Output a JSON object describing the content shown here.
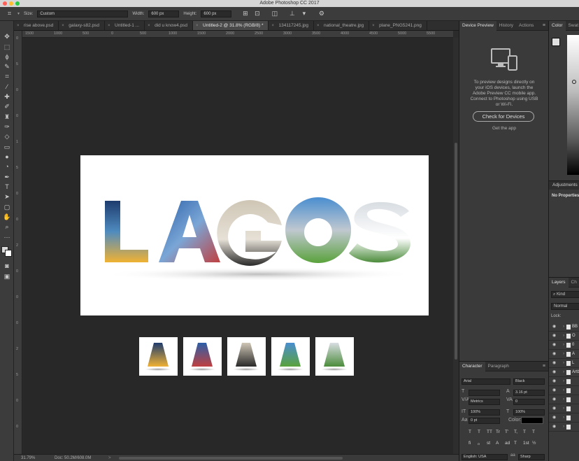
{
  "app": {
    "title": "Adobe Photoshop CC 2017"
  },
  "options_bar": {
    "size_label": "Size:",
    "size_value": "Custom",
    "width_label": "Width:",
    "width_value": "600 px",
    "height_label": "Height:",
    "height_value": "600 px"
  },
  "tabs": [
    {
      "label": "rise above.psd",
      "active": false
    },
    {
      "label": "galaxy-s82.psd",
      "active": false
    },
    {
      "label": "Untitled-1 ...",
      "active": false
    },
    {
      "label": "did u know4.psd",
      "active": false
    },
    {
      "label": "Untitled-2 @ 31.8% (RGB/8) *",
      "active": true
    },
    {
      "label": "134117245.jpg",
      "active": false
    },
    {
      "label": "national_theatre.jpg",
      "active": false
    },
    {
      "label": "plane_PNG5241.png",
      "active": false
    }
  ],
  "ruler_h": [
    "1500",
    "1000",
    "500",
    "0",
    "500",
    "1000",
    "1500",
    "2000",
    "2500",
    "3000",
    "3500",
    "4000",
    "4500",
    "5000",
    "5500",
    "6000"
  ],
  "ruler_v": [
    "0",
    "5",
    "0",
    "0",
    "1",
    "5",
    "0",
    "0",
    "2",
    "0",
    "0",
    "0",
    "2",
    "5",
    "0",
    "0"
  ],
  "canvas": {
    "artwork_text": "LAGOS",
    "thumbnails": [
      "L",
      "A",
      "G",
      "O",
      "S"
    ]
  },
  "status": {
    "zoom": "31.79%",
    "doc": "Doc: 50.2M/608.0M"
  },
  "device_preview": {
    "tabs": [
      "Device Preview",
      "History",
      "Actions"
    ],
    "text": "To preview designs directly on your iOS devices, launch the Adobe Preview CC mobile app. Connect to Photoshop using USB or Wi-Fi.",
    "button": "Check for Devices",
    "link": "Get the app"
  },
  "color_panel": {
    "tabs": [
      "Color",
      "Swat"
    ]
  },
  "adjustments": {
    "title": "Adjustments",
    "empty": "No Properties"
  },
  "layers": {
    "tabs": [
      "Layers",
      "Ch"
    ],
    "search_placeholder": "Kind",
    "blend_mode": "Normal",
    "lock_label": "Lock:",
    "items": [
      "BB",
      "O",
      "0",
      "A",
      "L",
      "Artbo",
      "",
      "",
      "",
      "",
      "",
      ""
    ]
  },
  "character": {
    "tabs": [
      "Character",
      "Paragraph"
    ],
    "font_family": "Arial",
    "font_style": "Black",
    "leading": "3.16 pt",
    "tracking_type": "Metrics",
    "tracking": "0",
    "vscale": "100%",
    "hscale": "100%",
    "baseline": "0 pt",
    "color_label": "Color:",
    "style_buttons": [
      "T",
      "T",
      "TT",
      "Tr",
      "T'",
      "T,",
      "T",
      "T"
    ],
    "opentype_buttons": [
      "fi",
      "ℴ",
      "st",
      "A",
      "ad",
      "T",
      "1st",
      "½"
    ],
    "language": "English: USA",
    "antialias": "Sharp"
  },
  "colors": {
    "ui_dark": "#2b2b2b",
    "panel": "#3a3a3a",
    "accent_canvas": "#ffffff"
  }
}
